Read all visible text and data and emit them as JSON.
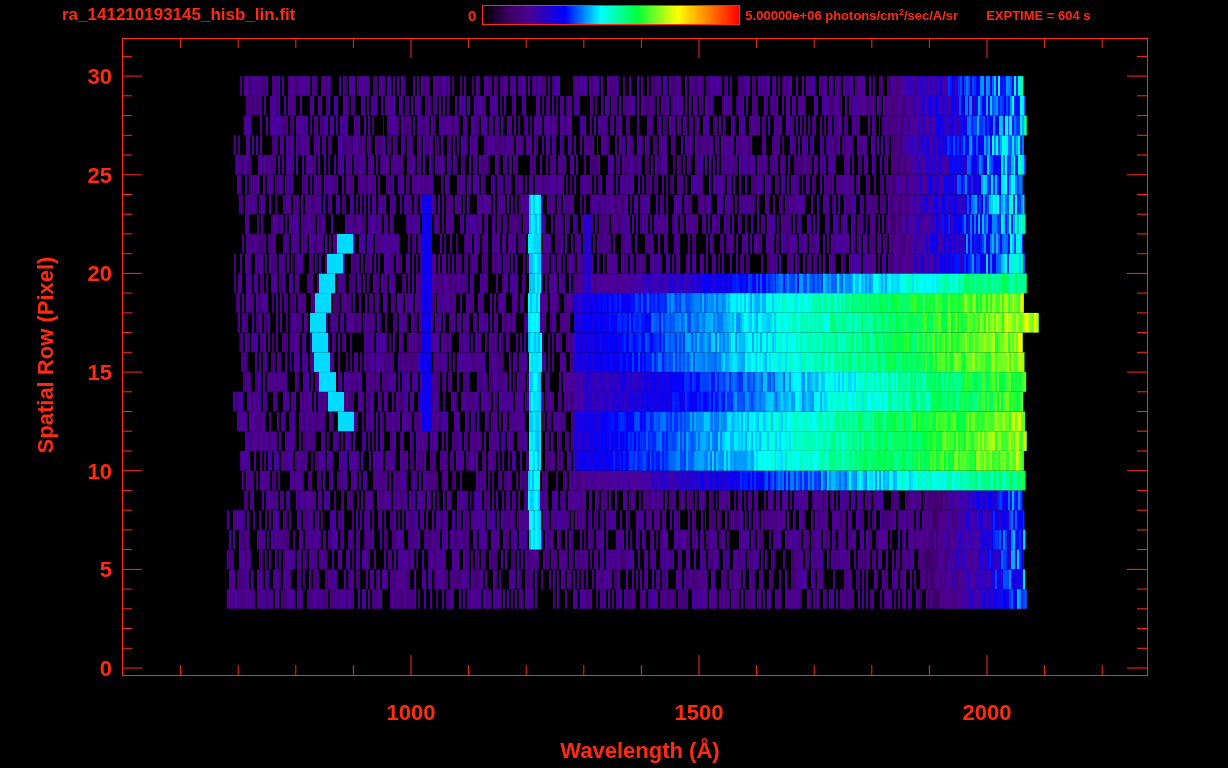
{
  "title": "ra_141210193145_hisb_lin.fit",
  "colorbar": {
    "min_label": "0",
    "max_label": "5.00000e+06 photons/cm$^{2}$/sec/A/sr"
  },
  "exposure": "EXPTIME = 604 s",
  "plot": {
    "x_axis": {
      "label": "Wavelength (Å)",
      "ticks": [
        "1000",
        "1500",
        "2000"
      ]
    },
    "y_axis": {
      "label": "Spatial Row (Pixel)",
      "ticks": [
        "30",
        "25",
        "20",
        "15",
        "10",
        "5",
        "0"
      ]
    }
  }
}
